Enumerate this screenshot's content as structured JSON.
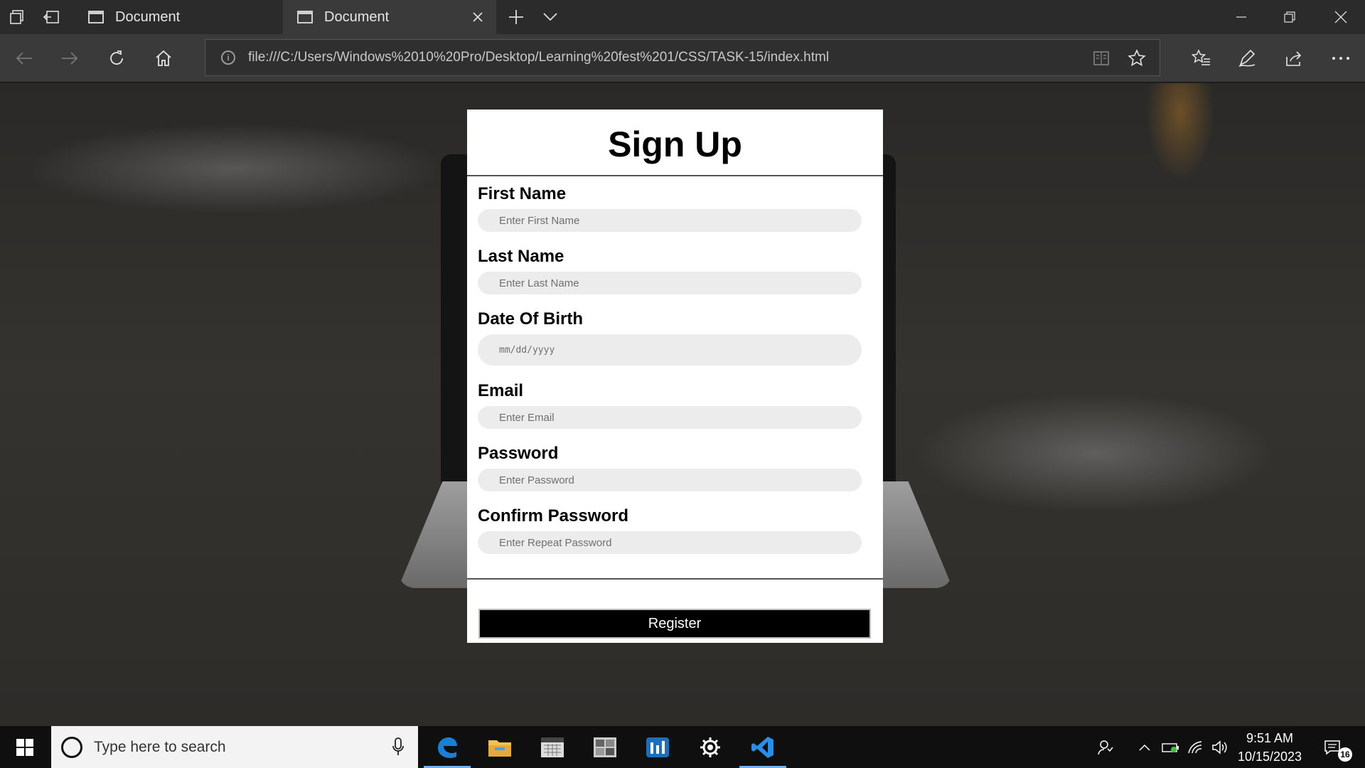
{
  "browser": {
    "tabs": [
      {
        "title": "Document",
        "active": false
      },
      {
        "title": "Document",
        "active": true
      }
    ],
    "address_bar": {
      "url": "file:///C:/Users/Windows%2010%20Pro/Desktop/Learning%20fest%201/CSS/TASK-15/index.html"
    },
    "icons": {
      "tab_actions": "tab-actions-icon",
      "set_aside": "set-aside-tabs-icon",
      "new_tab": "plus-icon",
      "tab_preview": "chevron-down-icon",
      "minimize": "minimize-icon",
      "restore": "restore-icon",
      "close": "close-icon",
      "back": "back-arrow-icon",
      "forward": "forward-arrow-icon",
      "refresh": "refresh-icon",
      "home": "home-icon",
      "reading_view": "reading-view-icon",
      "favorite": "star-icon",
      "favorites_hub": "favorites-hub-icon",
      "notes": "pen-icon",
      "share": "share-icon",
      "more": "more-icon"
    }
  },
  "form": {
    "title": "Sign Up",
    "fields": [
      {
        "label": "First Name",
        "placeholder": "Enter First Name"
      },
      {
        "label": "Last Name",
        "placeholder": "Enter Last Name"
      },
      {
        "label": "Date Of Birth",
        "placeholder": "mm/dd/yyyy"
      },
      {
        "label": "Email",
        "placeholder": "Enter Email"
      },
      {
        "label": "Password",
        "placeholder": "Enter Password"
      },
      {
        "label": "Confirm Password",
        "placeholder": "Enter Repeat Password"
      }
    ],
    "submit_label": "Register"
  },
  "taskbar": {
    "search_placeholder": "Type here to search",
    "apps": [
      "edge-icon",
      "file-explorer-icon",
      "calendar-app-icon",
      "photo-app-icon",
      "chart-app-icon",
      "settings-icon",
      "vscode-icon"
    ],
    "clock": {
      "time": "9:51 AM",
      "date": "10/15/2023"
    },
    "notification_count": "16",
    "colors": {
      "edge": "#1a7fd6",
      "folder": "#f2c14e",
      "vscode": "#2a8ee6",
      "accent_underline": "#6fb0ff"
    }
  }
}
